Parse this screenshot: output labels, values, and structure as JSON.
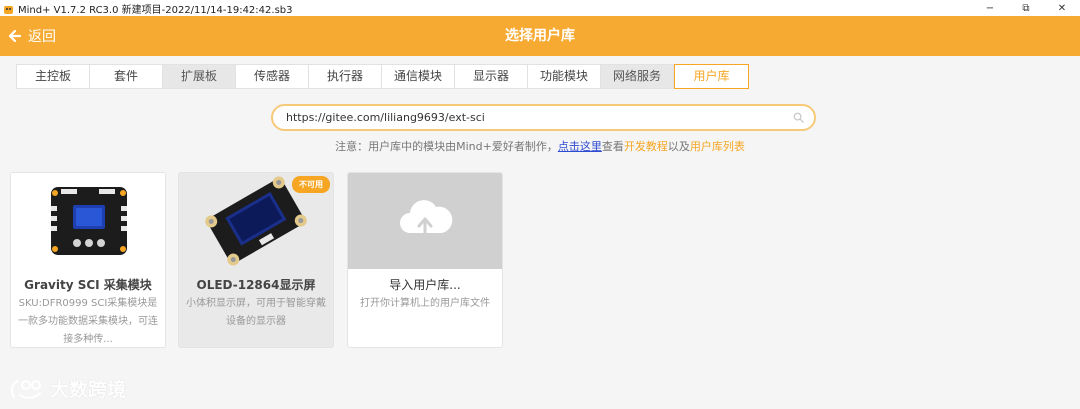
{
  "window": {
    "title": "Mind+ V1.7.2 RC3.0  新建项目-2022/11/14-19:42:42.sb3",
    "minimize": "−",
    "maximize": "⧉",
    "close": "✕"
  },
  "header": {
    "back_label": "返回",
    "title": "选择用户库"
  },
  "tabs": [
    {
      "label": "主控板",
      "state": "normal"
    },
    {
      "label": "套件",
      "state": "normal"
    },
    {
      "label": "扩展板",
      "state": "grey"
    },
    {
      "label": "传感器",
      "state": "normal"
    },
    {
      "label": "执行器",
      "state": "normal"
    },
    {
      "label": "通信模块",
      "state": "normal"
    },
    {
      "label": "显示器",
      "state": "normal"
    },
    {
      "label": "功能模块",
      "state": "normal"
    },
    {
      "label": "网络服务",
      "state": "grey"
    },
    {
      "label": "用户库",
      "state": "active"
    }
  ],
  "search": {
    "value": "https://gitee.com/liliang9693/ext-sci"
  },
  "notice": {
    "prefix": "注意：用户库中的模块由Mind+爱好者制作，",
    "link_here": "点击这里",
    "middle": "查看",
    "link_tutorial": "开发教程",
    "and": "以及",
    "link_list": "用户库列表"
  },
  "cards": [
    {
      "name": "Gravity SCI 采集模块",
      "desc": "SKU:DFR0999 SCI采集模块是一款多功能数据采集模块，可连接多种传..."
    },
    {
      "name": "OLED-12864显示屏",
      "desc": "小体积显示屏，可用于智能穿戴设备的显示器",
      "badge": "不可用"
    },
    {
      "name": "导入用户库...",
      "desc": "打开你计算机上的用户库文件"
    }
  ],
  "watermark": "大数跨境",
  "colors": {
    "accent": "#f7aa31",
    "link": "#2d4bd0"
  }
}
